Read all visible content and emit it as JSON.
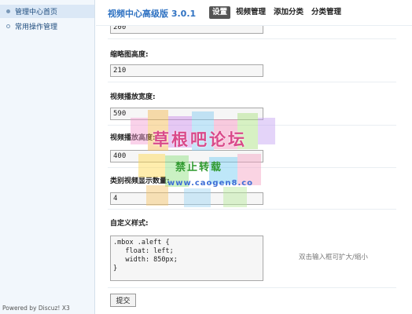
{
  "sidebar": {
    "items": [
      {
        "label": "管理中心首页",
        "active": true
      },
      {
        "label": "常用操作管理",
        "active": false
      }
    ],
    "powered_by": "Powered by Discuz! X3"
  },
  "header": {
    "app_title": "视频中心高级版 3.0.1",
    "tabs": [
      {
        "label": "设置",
        "active": true
      },
      {
        "label": "视频管理"
      },
      {
        "label": "添加分类"
      },
      {
        "label": "分类管理"
      }
    ]
  },
  "form": {
    "partial_value": "200",
    "thumb_height_label": "缩略图高度:",
    "thumb_height_value": "210",
    "player_width_label": "视频播放宽度:",
    "player_width_value": "590",
    "player_height_label": "视频播放高度:",
    "player_height_value": "400",
    "category_count_label": "类别视频显示数量:",
    "category_count_value": "4",
    "custom_style_label": "自定义样式:",
    "custom_style_value": ".mbox .aleft {\n   float: left;\n   width: 850px;\n}",
    "custom_style_hint": "双击输入框可扩大/缩小",
    "submit_label": "提交"
  },
  "watermark": {
    "line1": "草根吧论坛",
    "line2": "禁止转载",
    "line3": "www.caogen8.co"
  }
}
